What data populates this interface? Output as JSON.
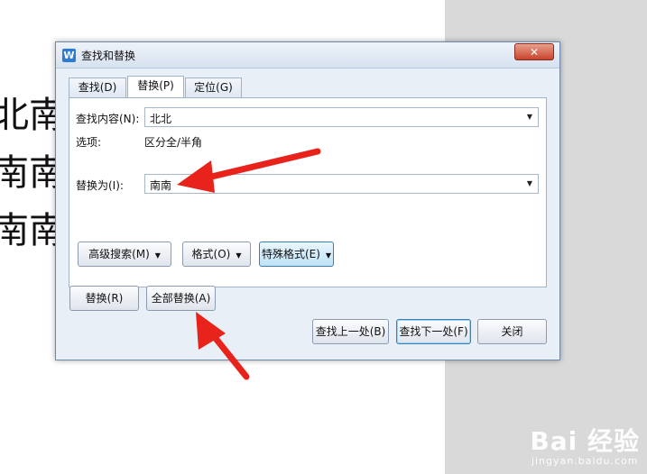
{
  "document": {
    "lines": [
      "北南",
      "南南",
      "南南"
    ]
  },
  "dialog": {
    "title": "查找和替换",
    "close_label": "✕",
    "tabs": [
      {
        "label": "查找(D)",
        "active": false
      },
      {
        "label": "替换(P)",
        "active": true
      },
      {
        "label": "定位(G)",
        "active": false
      }
    ],
    "find_label": "查找内容(N):",
    "find_value": "北北",
    "options_label": "选项:",
    "options_value": "区分全/半角",
    "replace_label": "替换为(I):",
    "replace_value": "南南",
    "advanced_search_label": "高级搜索(M)",
    "format_label": "格式(O)",
    "special_format_label": "特殊格式(E)",
    "replace_button": "替换(R)",
    "replace_all_button": "全部替换(A)",
    "find_prev_button": "查找上一处(B)",
    "find_next_button": "查找下一处(F)",
    "close_button": "关闭"
  },
  "watermark": {
    "logo": "Bai 经验",
    "url": "jingyan.baidu.com"
  },
  "colors": {
    "arrow": "#e8231b",
    "accent": "#3c7fb1"
  },
  "icons": {
    "app": "wps-writer-icon",
    "dropdown": "chevron-down-icon"
  }
}
